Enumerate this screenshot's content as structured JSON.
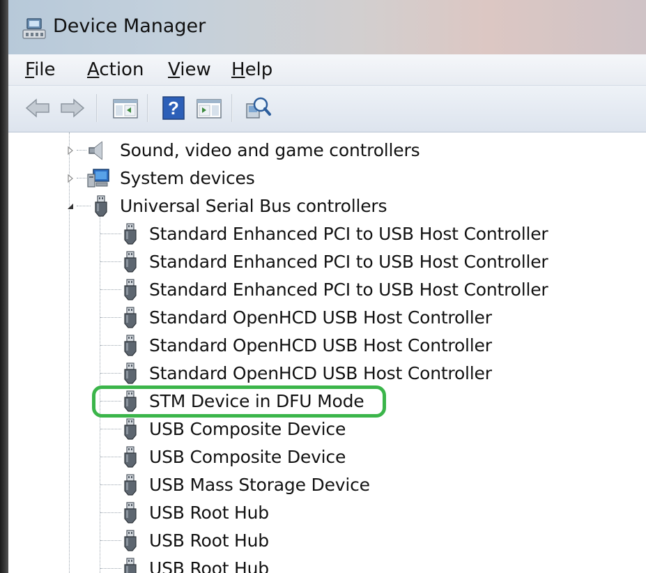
{
  "window": {
    "title": "Device Manager"
  },
  "menu": {
    "items": [
      {
        "label": "File"
      },
      {
        "label": "Action"
      },
      {
        "label": "View"
      },
      {
        "label": "Help"
      }
    ]
  },
  "toolbar": {
    "icons": [
      "back-arrow-icon",
      "forward-arrow-icon",
      "show-hide-console-tree-icon",
      "help-icon",
      "show-hide-action-pane-icon",
      "scan-hardware-changes-icon"
    ]
  },
  "tree": {
    "categories": [
      {
        "label": "Sound, video and game controllers",
        "expanded": false,
        "icon": "speaker-icon"
      },
      {
        "label": "System devices",
        "expanded": false,
        "icon": "computer-icon"
      },
      {
        "label": "Universal Serial Bus controllers",
        "expanded": true,
        "icon": "usb-plug-icon"
      }
    ],
    "usb_children": [
      {
        "label": "Standard Enhanced PCI to USB Host Controller"
      },
      {
        "label": "Standard Enhanced PCI to USB Host Controller"
      },
      {
        "label": "Standard Enhanced PCI to USB Host Controller"
      },
      {
        "label": "Standard OpenHCD USB Host Controller"
      },
      {
        "label": "Standard OpenHCD USB Host Controller"
      },
      {
        "label": "Standard OpenHCD USB Host Controller"
      },
      {
        "label": "STM Device in DFU Mode",
        "highlighted": true
      },
      {
        "label": "USB Composite Device"
      },
      {
        "label": "USB Composite Device"
      },
      {
        "label": "USB Mass Storage Device"
      },
      {
        "label": "USB Root Hub"
      },
      {
        "label": "USB Root Hub"
      },
      {
        "label": "USB Root Hub"
      }
    ]
  },
  "colors": {
    "highlight_outline": "#3bb54a"
  }
}
